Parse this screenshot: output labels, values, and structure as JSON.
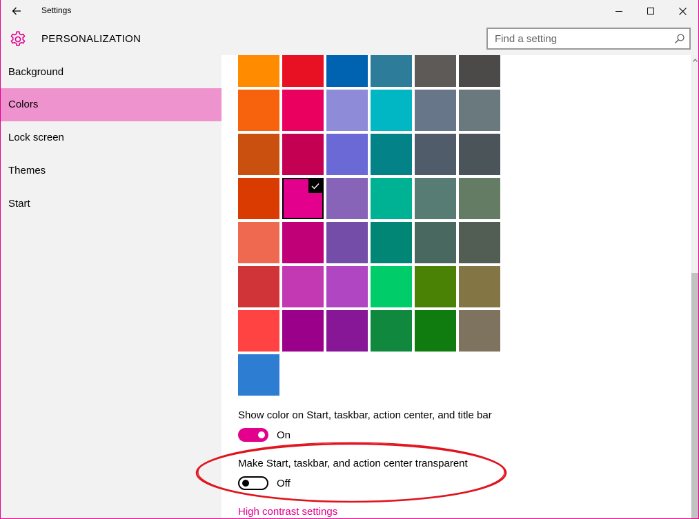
{
  "window": {
    "title": "Settings"
  },
  "header": {
    "title": "PERSONALIZATION",
    "search_placeholder": "Find a setting"
  },
  "sidebar": {
    "items": [
      {
        "label": "Background"
      },
      {
        "label": "Colors"
      },
      {
        "label": "Lock screen"
      },
      {
        "label": "Themes"
      },
      {
        "label": "Start"
      }
    ],
    "selected": "Colors"
  },
  "accent_colors": [
    [
      "#ff8c00",
      "#e81123",
      "#0063b1",
      "#2d7d9a",
      "#5d5a58",
      "#4c4a48"
    ],
    [
      "#f7630c",
      "#ea005e",
      "#8e8cd8",
      "#00b7c3",
      "#68768a",
      "#69797e"
    ],
    [
      "#ca5010",
      "#c30052",
      "#6b69d6",
      "#038387",
      "#515c6b",
      "#4a5459"
    ],
    [
      "#da3b01",
      "#e3008c",
      "#8764b8",
      "#00b294",
      "#567c73",
      "#647c64"
    ],
    [
      "#ef6950",
      "#bf0077",
      "#744da9",
      "#018574",
      "#486860",
      "#525e54"
    ],
    [
      "#d13438",
      "#c239b3",
      "#b146c2",
      "#00cc6a",
      "#498205",
      "#847545"
    ],
    [
      "#ff4343",
      "#9a0089",
      "#881798",
      "#10893e",
      "#107c10",
      "#7e735f"
    ],
    [
      "#2d7dd2"
    ]
  ],
  "selected_color": "#e3008c",
  "settings": {
    "show_color": {
      "label": "Show color on Start, taskbar, action center, and title bar",
      "state": "On",
      "on": true
    },
    "transparent": {
      "label": "Make Start, taskbar, and action center transparent",
      "state": "Off",
      "on": false
    },
    "high_contrast_link": "High contrast settings"
  },
  "theme": {
    "accent": "#e3008c",
    "annotation": "#e0141e"
  }
}
